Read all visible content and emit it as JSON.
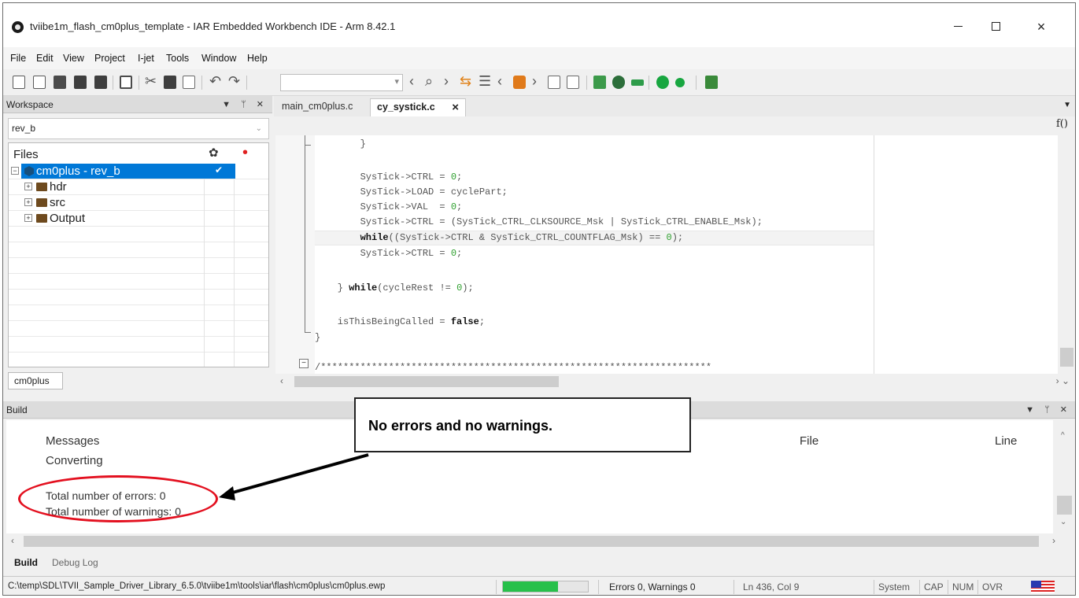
{
  "window": {
    "title": "tviibe1m_flash_cm0plus_template - IAR Embedded Workbench IDE - Arm 8.42.1",
    "minimize": "—",
    "close": "×"
  },
  "menu": [
    "File",
    "Edit",
    "View",
    "Project",
    "I-jet",
    "Tools",
    "Window",
    "Help"
  ],
  "workspace": {
    "title": "Workspace",
    "pin": "▼ ᛘ ✕",
    "config": "rev_b",
    "files_header": "Files",
    "gear": "✿",
    "dot": "•",
    "tree": [
      {
        "label": "cm0plus - rev_b",
        "check": "✔",
        "expander": "−",
        "selected": true
      },
      {
        "label": "hdr",
        "expander": "+"
      },
      {
        "label": "src",
        "expander": "+"
      },
      {
        "label": "Output",
        "expander": "+"
      }
    ],
    "tab": "cm0plus"
  },
  "editor": {
    "tabs": [
      {
        "label": "main_cm0plus.c",
        "active": false
      },
      {
        "label": "cy_systick.c",
        "active": true,
        "close": "×"
      }
    ],
    "func_icon": "f()",
    "code": [
      [
        "        }"
      ],
      [
        ""
      ],
      [
        "        SysTick->CTRL = ",
        "0",
        ";"
      ],
      [
        "        SysTick->LOAD = cyclePart;"
      ],
      [
        "        SysTick->VAL  = ",
        "0",
        ";"
      ],
      [
        "        SysTick->CTRL = (SysTick_CTRL_CLKSOURCE_Msk | SysTick_CTRL_ENABLE_Msk);"
      ],
      [
        "        ",
        "while",
        "((SysTick->CTRL & SysTick_CTRL_COUNTFLAG_Msk) == ",
        "0",
        ");"
      ],
      [
        "        SysTick->CTRL = ",
        "0",
        ";"
      ],
      [
        ""
      ],
      [
        "    } ",
        "while",
        "(cycleRest != ",
        "0",
        ");"
      ],
      [
        ""
      ],
      [
        "    isThisBeingCalled = ",
        "false",
        ";"
      ],
      [
        "}"
      ],
      [
        ""
      ],
      [
        "/*********************************************************************"
      ]
    ]
  },
  "build": {
    "title": "Build",
    "columns": {
      "messages": "Messages",
      "file": "File",
      "line": "Line"
    },
    "messages": [
      "Converting",
      "",
      "Total number of errors: 0",
      "Total number of warnings: 0"
    ],
    "tabs": [
      "Build",
      "Debug Log"
    ]
  },
  "annotation": {
    "callout": "No errors and no warnings."
  },
  "statusbar": {
    "path": "C:\\temp\\SDL\\TVII_Sample_Driver_Library_6.5.0\\tviibe1m\\tools\\iar\\flash\\cm0plus\\cm0plus.ewp",
    "progress": 0.65,
    "summary": "Errors 0, Warnings 0",
    "position": "Ln 436, Col 9",
    "system": "System",
    "cap": "CAP",
    "num": "NUM",
    "ovr": "OVR"
  },
  "colors": {
    "selection": "#0078d7",
    "progress": "#27c04a",
    "highlight_ring": "#e3101f"
  }
}
